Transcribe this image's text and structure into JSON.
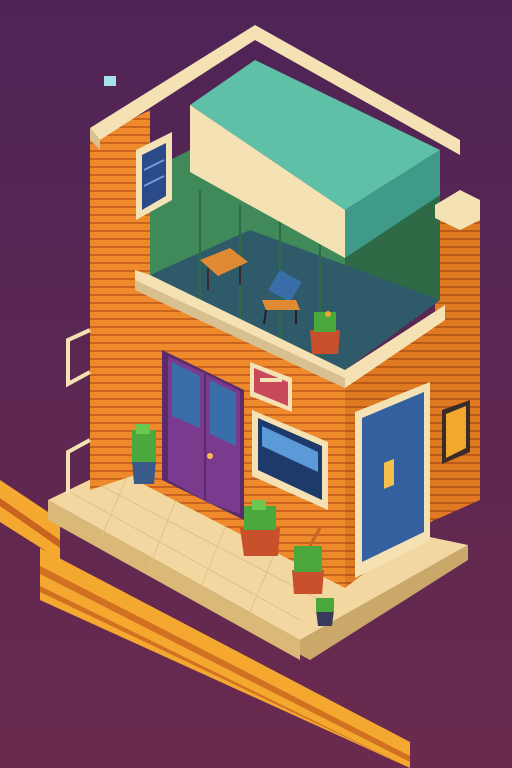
{
  "scene": {
    "subject": "isometric-pixel-art-shop",
    "colors": {
      "background_top": "#4e2456",
      "background_bottom": "#6a2a4e",
      "brick_orange": "#ee8a2c",
      "brick_dark": "#c8641e",
      "trim_cream": "#f4e2b4",
      "roof_teal": "#5fc0a8",
      "interior_green": "#3f8a58",
      "door_purple": "#7a3a8e",
      "glass_blue": "#3a6ea8",
      "side_door_blue": "#3560a0",
      "sidewalk_tile": "#f2d8a0",
      "road_stripe": "#f4a830",
      "plant_green": "#4aa83c",
      "pot_terracotta": "#c8502a"
    },
    "icons": [
      "window-icon",
      "shop-sign-icon",
      "wall-lamp-icon",
      "table-icon",
      "chair-icon",
      "potted-plant-icon",
      "drainpipe-icon"
    ]
  }
}
